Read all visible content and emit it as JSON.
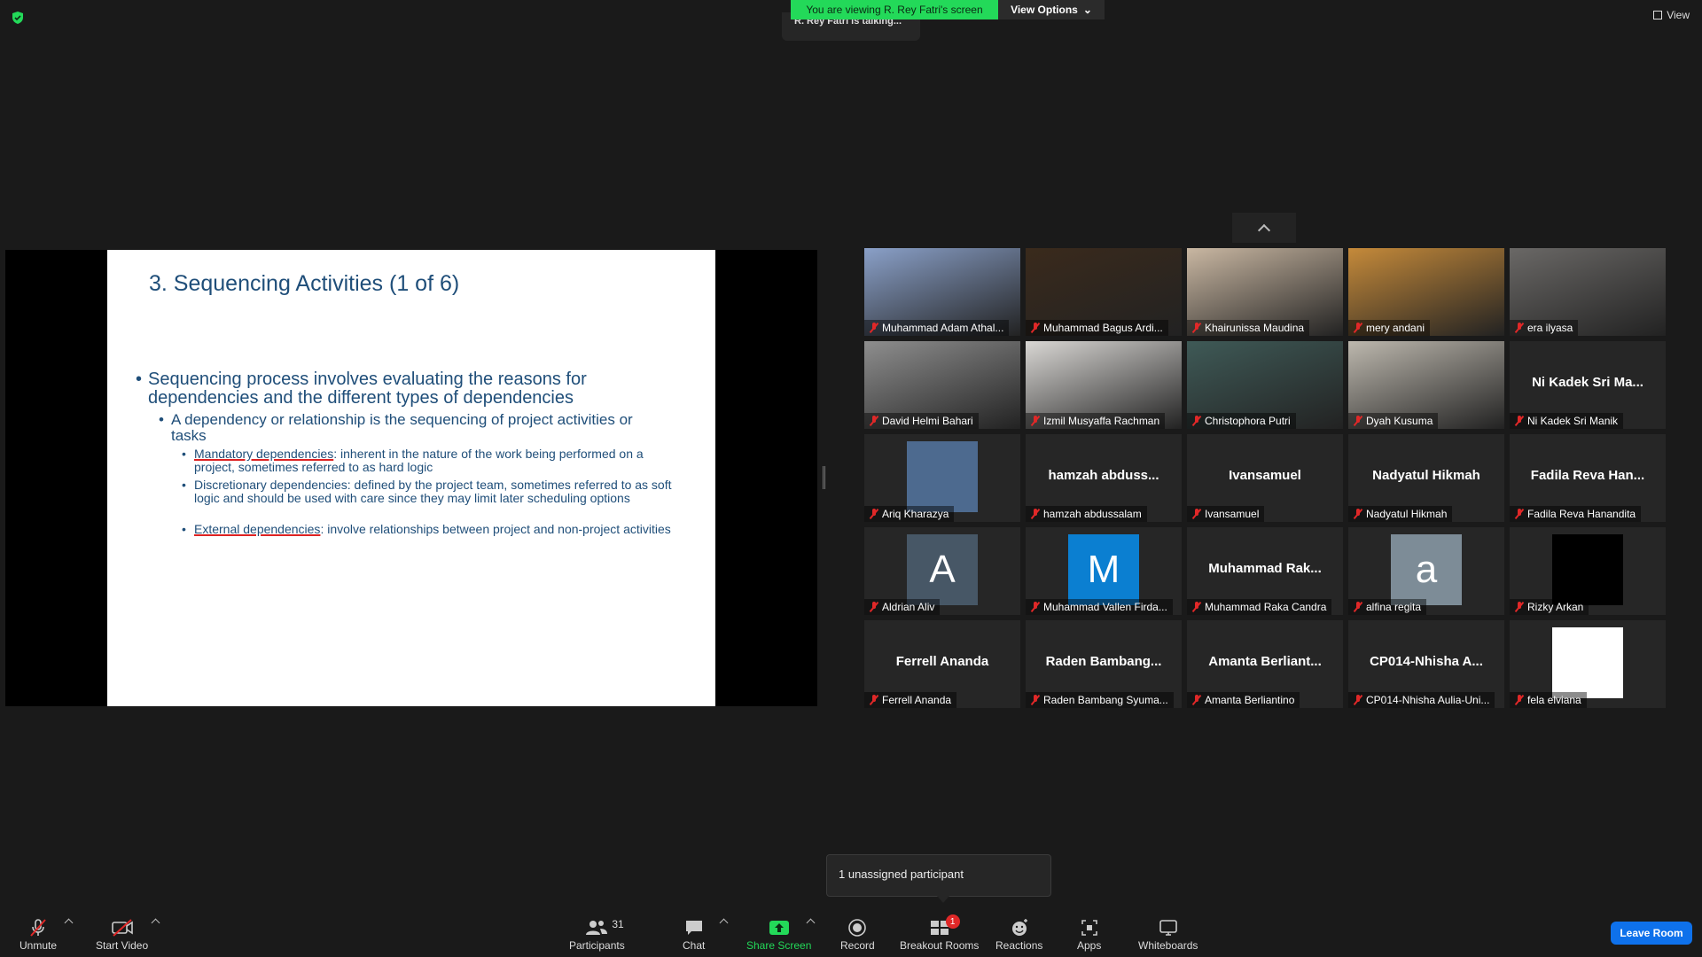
{
  "top": {
    "viewing_text": "You are viewing R. Rey Fatri's screen",
    "view_options_label": "View Options",
    "talking_text": "R. Rey Fatri is talking...",
    "view_label": "View"
  },
  "slide": {
    "title": "3. Sequencing Activities (1 of 6)",
    "bullet1": "Sequencing process involves evaluating the reasons for dependencies and the different types of dependencies",
    "bullet2": "A dependency or relationship is the sequencing of project activities or tasks",
    "sub1_term": "Mandatory dependencies",
    "sub1_rest": ": inherent in the nature of the work being performed on a project, sometimes referred to as hard logic",
    "sub2_term": "Discretionary dependencies",
    "sub2_rest": ": defined by the project team, sometimes referred to as soft logic and should be used with care since they may limit later scheduling options",
    "sub3_term": "External dependencies",
    "sub3_rest": ": involve relationships between project and non-project activities"
  },
  "participants": [
    {
      "name": "Muhammad Adam Athal...",
      "tile": "video",
      "color": "#8aa0c8"
    },
    {
      "name": "Muhammad Bagus Ardi...",
      "tile": "video",
      "color": "#3a2a1c"
    },
    {
      "name": "Khairunissa Maudina",
      "tile": "video",
      "color": "#c9b7a2"
    },
    {
      "name": "mery andani",
      "tile": "video",
      "color": "#c58a3a"
    },
    {
      "name": "era ilyasa",
      "tile": "video",
      "color": "#6a6866"
    },
    {
      "name": "David Helmi Bahari",
      "tile": "video",
      "color": "#8e8e8e"
    },
    {
      "name": "Izmil Musyaffa Rachman",
      "tile": "video",
      "color": "#d9d7d4"
    },
    {
      "name": "Christophora Putri",
      "tile": "video",
      "color": "#3f5a57"
    },
    {
      "name": "Dyah Kusuma",
      "tile": "video",
      "color": "#bdb8ae"
    },
    {
      "name": "Ni Kadek Sri Manik",
      "tile": "text",
      "big": "Ni Kadek Sri Ma..."
    },
    {
      "name": "Ariq Kharazya",
      "tile": "photo",
      "color": "#4d6a8f"
    },
    {
      "name": "hamzah abdussalam",
      "tile": "text",
      "big": "hamzah  abduss..."
    },
    {
      "name": "Ivansamuel",
      "tile": "text",
      "big": "Ivansamuel"
    },
    {
      "name": "Nadyatul Hikmah",
      "tile": "text",
      "big": "Nadyatul Hikmah"
    },
    {
      "name": "Fadila Reva Hanandita",
      "tile": "text",
      "big": "Fadila Reva Han..."
    },
    {
      "name": "Aldrian Aliv",
      "tile": "letter",
      "letter": "A",
      "color": "#475766"
    },
    {
      "name": "Muhammad Vallen Firda...",
      "tile": "letter",
      "letter": "M",
      "color": "#0b7fd1"
    },
    {
      "name": "Muhammad Raka Candra",
      "tile": "text",
      "big": "Muhammad  Rak..."
    },
    {
      "name": "alfina regita",
      "tile": "letter",
      "letter": "a",
      "color": "#7d8c97"
    },
    {
      "name": "Rizky Arkan",
      "tile": "photo",
      "color": "#000000"
    },
    {
      "name": "Ferrell Ananda",
      "tile": "text",
      "big": "Ferrell Ananda"
    },
    {
      "name": "Raden Bambang Syuma...",
      "tile": "text",
      "big": "Raden  Bambang..."
    },
    {
      "name": "Amanta Berliantino",
      "tile": "text",
      "big": "Amanta  Berliant..."
    },
    {
      "name": "CP014-Nhisha Aulia-Uni...",
      "tile": "text",
      "big": "CP014-Nhisha  A..."
    },
    {
      "name": "fela elviana",
      "tile": "photo",
      "color": "#ffffff"
    }
  ],
  "toast": "1 unassigned participant",
  "toolbar": {
    "unmute": "Unmute",
    "start_video": "Start Video",
    "participants": "Participants",
    "participants_count": "31",
    "chat": "Chat",
    "share_screen": "Share Screen",
    "record": "Record",
    "breakout_rooms": "Breakout Rooms",
    "breakout_badge": "1",
    "reactions": "Reactions",
    "apps": "Apps",
    "whiteboards": "Whiteboards",
    "leave": "Leave Room"
  },
  "colors": {
    "share_green": "#23d959",
    "leave_blue": "#0e71eb",
    "mic_red": "#e02828",
    "slide_text": "#1f4e79"
  }
}
